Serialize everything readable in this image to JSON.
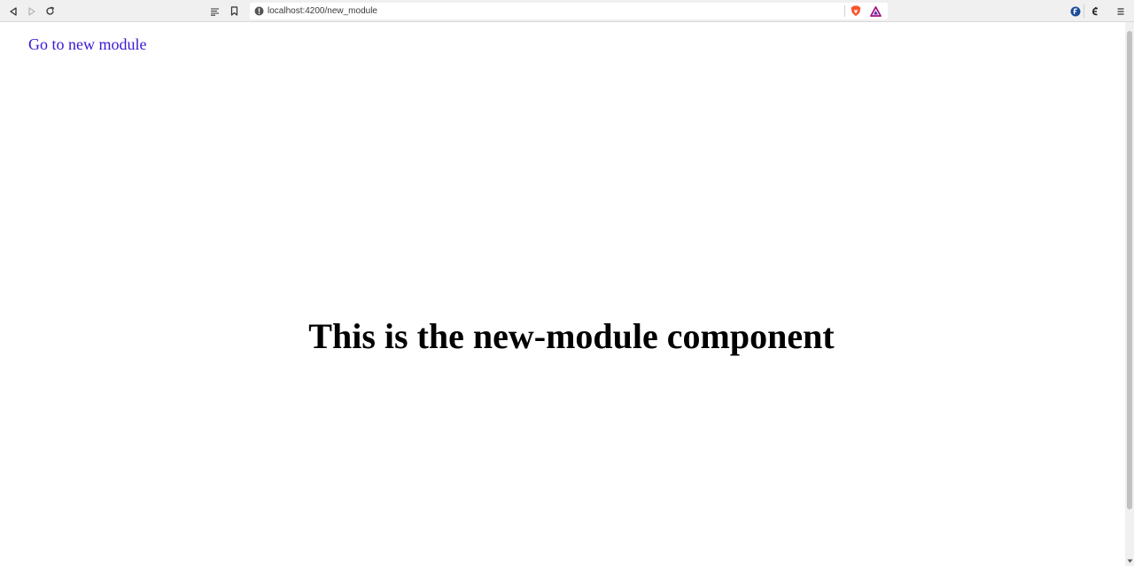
{
  "browser": {
    "url": "localhost:4200/new_module",
    "icons": {
      "back": "back-arrow-icon",
      "forward": "forward-arrow-icon",
      "reload": "reload-icon",
      "reader": "reader-mode-icon",
      "bookmark": "bookmark-icon",
      "site_info": "site-info-icon",
      "brave_shield": "brave-shield-icon",
      "brave_rewards": "brave-rewards-icon",
      "extension_1": "extension-icon",
      "extension_2": "extension-icon",
      "menu": "menu-icon"
    },
    "colors": {
      "shield": "#fb542b",
      "rewards_a": "#a80f80",
      "rewards_b": "#4f30ab",
      "extension_1": "#1e4e9a"
    }
  },
  "page": {
    "link_text": "Go to new module",
    "heading": "This is the new-module component",
    "colors": {
      "link": "#3c16d6",
      "heading": "#000000"
    }
  }
}
